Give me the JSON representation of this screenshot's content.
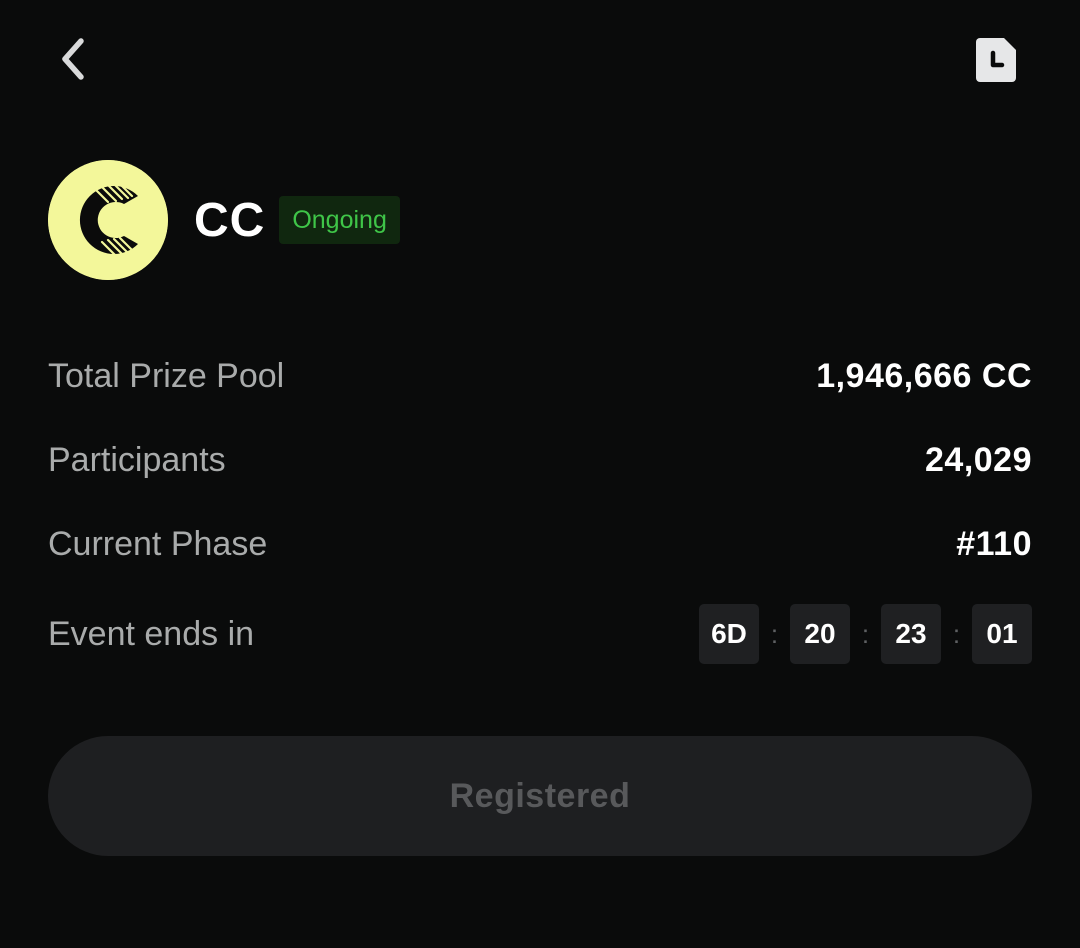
{
  "topbar": {
    "back_icon": "chevron-left-icon",
    "history_icon": "clock-document-icon"
  },
  "token": {
    "logo_icon": "cc-coin-logo",
    "logo_color": "#f3f79a",
    "name": "CC",
    "status": "Ongoing",
    "status_color": "#3fc548"
  },
  "stats": {
    "prize_pool": {
      "label": "Total Prize Pool",
      "value": "1,946,666 CC"
    },
    "participants": {
      "label": "Participants",
      "value": "24,029"
    },
    "phase": {
      "label": "Current Phase",
      "value": "#110"
    },
    "ends": {
      "label": "Event ends in",
      "days": "6D",
      "hours": "20",
      "minutes": "23",
      "seconds": "01",
      "separator": ":"
    }
  },
  "action": {
    "label": "Registered"
  }
}
